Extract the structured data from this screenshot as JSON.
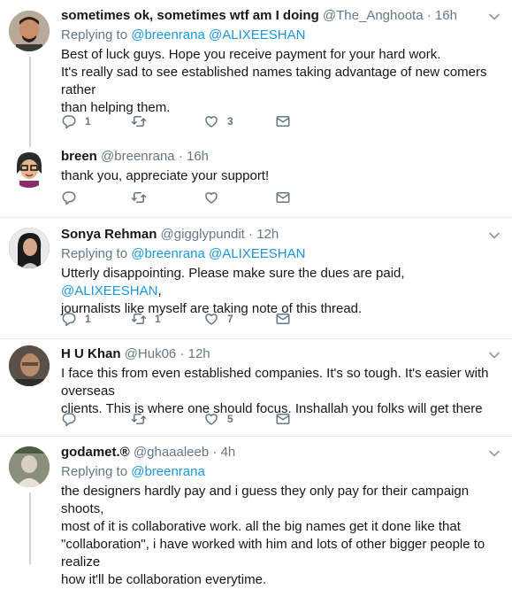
{
  "tweets": [
    {
      "name": "sometimes ok, sometimes wtf am I doing",
      "handle": "@The_Anghoota",
      "dot": "·",
      "time": "16h",
      "replying_prefix": "Replying to",
      "replying_mentions": [
        "@breenrana",
        "@ALIXEESHAN"
      ],
      "text_lines": [
        "Best of luck guys. Hope you receive payment for your hard work.",
        "It's really sad to see established names taking advantage of new comers rather",
        "than helping them."
      ],
      "reply_count": "1",
      "retweet_count": "",
      "like_count": "3"
    },
    {
      "name": "breen",
      "handle": "@breenrana",
      "dot": "·",
      "time": "16h",
      "text_lines": [
        "thank you, appreciate your support!"
      ],
      "reply_count": "",
      "retweet_count": "",
      "like_count": ""
    },
    {
      "name": "Sonya Rehman",
      "handle": "@gigglypundit",
      "dot": "·",
      "time": "12h",
      "replying_prefix": "Replying to",
      "replying_mentions": [
        "@breenrana",
        "@ALIXEESHAN"
      ],
      "text_part1": "Utterly disappointing. Please make sure the dues are paid,",
      "text_mention": "@ALIXEESHAN",
      "text_part2": ",",
      "text_line2": "journalists like myself are taking note of this thread.",
      "reply_count": "1",
      "retweet_count": "1",
      "like_count": "7"
    },
    {
      "name": "H U Khan",
      "handle": "@Huk06",
      "dot": "·",
      "time": "12h",
      "text_lines": [
        "I face this from even established companies. It's so tough. It's easier with overseas",
        "clients. This is where one should focus. Inshallah you folks will get there"
      ],
      "reply_count": "",
      "retweet_count": "",
      "like_count": "5"
    },
    {
      "name": "godamet.®",
      "handle": "@ghaaaleeb",
      "dot": "·",
      "time": "4h",
      "replying_prefix": "Replying to",
      "replying_mentions": [
        "@breenrana"
      ],
      "text_lines": [
        "the designers hardly pay and i guess they only pay for their campaign shoots,",
        "most of it is collaborative work. all the big names get it done like that",
        "\"collaboration\", i have worked with him and lots of other bigger people to realize",
        "how it'll be collaboration everytime."
      ]
    }
  ],
  "colors": {
    "link": "#1b95e0",
    "muted": "#657786",
    "text": "#14171a",
    "border": "#e6ecf0"
  },
  "icons": [
    "reply-icon",
    "retweet-icon",
    "like-icon",
    "direct-message-icon",
    "chevron-down-icon"
  ]
}
